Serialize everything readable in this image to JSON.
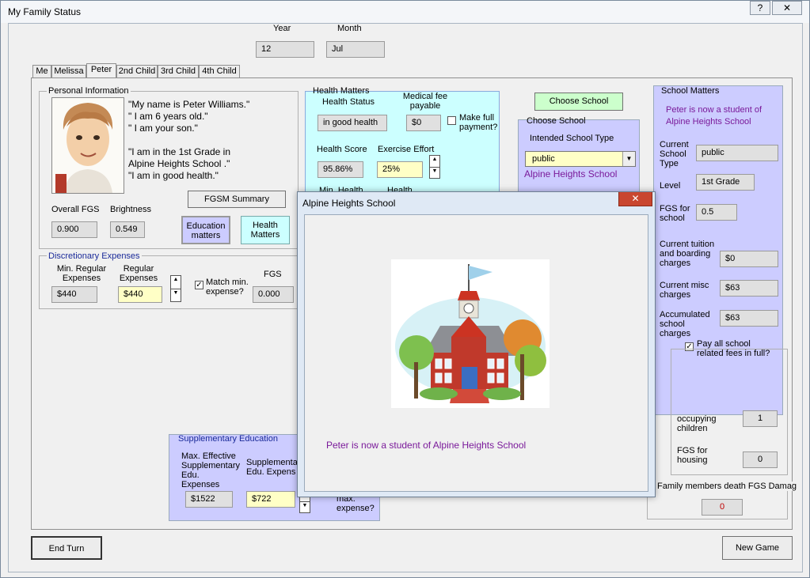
{
  "window": {
    "title": "My Family Status",
    "help_label": "?",
    "close_label": "✕"
  },
  "period": {
    "year_label": "Year",
    "month_label": "Month",
    "year_value": "12",
    "month_value": "Jul"
  },
  "tabs": [
    "Me",
    "Melissa",
    "Peter",
    "2nd Child",
    "3rd Child",
    "4th Child"
  ],
  "personal": {
    "title": "Personal Information",
    "speech": [
      "\"My name is Peter Williams.\"",
      "\" I am 6 years old.\"",
      "\" I am your son.\"",
      "\"I am in the 1st Grade  in",
      "Alpine Heights School  .\"",
      "\"I am in good health.\""
    ],
    "overall_fgs_label": "Overall FGS",
    "overall_fgs_value": "0.900",
    "brightness_label": "Brightness",
    "brightness_value": "0.549",
    "fgsm_button": "FGSM Summary",
    "education_button": "Education matters",
    "health_button": "Health Matters"
  },
  "disc": {
    "title": "Discretionary Expenses",
    "min_label": "Min. Regular Expenses",
    "min_value": "$440",
    "reg_label": "Regular Expenses",
    "reg_value": "$440",
    "match_label": "Match min. expense?",
    "match_checked": "✓",
    "fgs_label": "FGS",
    "fgs_value": "0.000"
  },
  "health": {
    "title": "Health Matters",
    "status_label": "Health Status",
    "status_value": "in good health",
    "fee_label": "Medical fee payable",
    "fee_value": "$0",
    "full_label": "Make full payment?",
    "score_label": "Health Score",
    "score_value": "95.86%",
    "effort_label": "Exercise Effort",
    "effort_value": "25%",
    "min_health_label": "Min. Health",
    "health_label": "Health"
  },
  "choose": {
    "button": "Choose School",
    "title": "Choose School",
    "type_label": "Intended School Type",
    "type_value": "public",
    "school_name": "Alpine Heights School"
  },
  "school": {
    "title": "School Matters",
    "status_text": "Peter is now a student of Alpine Heights School",
    "current_type_label": "Current School Type",
    "current_type_value": "public",
    "level_label": "Level",
    "level_value": "1st Grade",
    "fgs_label": "FGS for school",
    "fgs_value": "0.5",
    "tuition_label": "Current tuition and boarding charges",
    "tuition_value": "$0",
    "misc_label": "Current misc charges",
    "misc_value": "$63",
    "accum_label": "Accumulated school charges",
    "accum_value": "$63",
    "payall_label": "Pay all school related fees in full?",
    "payall_checked": "✓"
  },
  "housing": {
    "occupying_label": "occupying children",
    "occupying_value": "1",
    "fgs_label": "FGS for housing",
    "fgs_value": "0"
  },
  "death": {
    "label": "Family members death FGS Damag",
    "value": "0"
  },
  "supp": {
    "title": "Supplementary Education",
    "max_label": "Max. Effective Supplementary Edu. Expenses",
    "max_value": "$1522",
    "supp_label": "Supplementar Edu. Expens",
    "supp_value": "$722",
    "max_chk_label": "max. expense?"
  },
  "dialog": {
    "title": "Alpine Heights School",
    "close_label": "✕",
    "message": "Peter is now a student of Alpine Heights School"
  },
  "footer": {
    "end_turn": "End Turn",
    "new_game": "New Game"
  },
  "colors": {
    "lavender": "#ccccff",
    "cyan": "#ccffff",
    "purple": "#7a1a9a",
    "close_red": "#c9462f"
  }
}
